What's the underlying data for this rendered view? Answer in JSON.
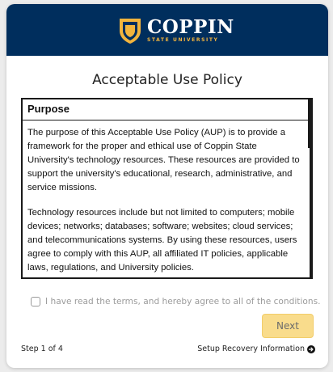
{
  "brand": {
    "name": "COPPIN",
    "subtitle": "STATE UNIVERSITY",
    "colors": {
      "header": "#002e5d",
      "gold": "#f2b43d",
      "button": "#f9dc8c"
    }
  },
  "page": {
    "title": "Acceptable Use Policy"
  },
  "policy": {
    "heading": "Purpose",
    "paragraph1": "The purpose of this Acceptable Use Policy (AUP) is to provide a framework for the proper and ethical use of Coppin State University's technology resources. These resources are provided to support the university's educational, research, administrative, and service missions.",
    "paragraph2": "Technology resources include but not limited to computers; mobile devices; networks; databases; software; websites; cloud services; and telecommunications systems. By using these resources, users agree to comply with this AUP, all affiliated IT policies, applicable laws, regulations, and University policies."
  },
  "agreement": {
    "label": "I have read the terms, and hereby agree to all of the conditions.",
    "checked": false
  },
  "actions": {
    "next_label": "Next"
  },
  "footer": {
    "step": "Step 1 of 4",
    "next_step_label": "Setup Recovery Information",
    "next_step_icon": "arrow-circle-right-icon"
  }
}
